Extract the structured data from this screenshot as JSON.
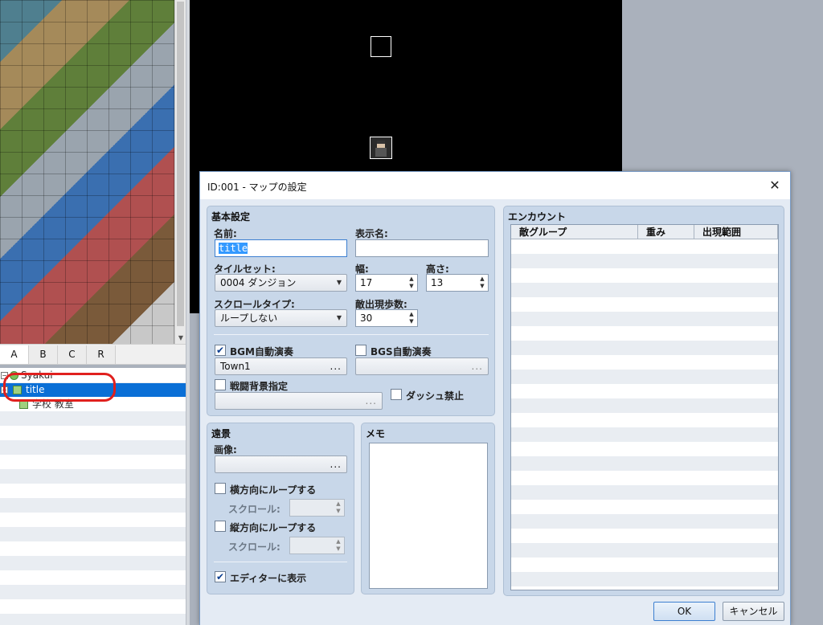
{
  "tileset_tabs": [
    "A",
    "B",
    "C",
    "R"
  ],
  "map_tree": {
    "items": [
      {
        "label": "Syakui"
      },
      {
        "label": "title"
      },
      {
        "label": "学校 教室"
      }
    ]
  },
  "dialog": {
    "title": "ID:001 - マップの設定",
    "close_glyph": "✕",
    "basic": {
      "group_title": "基本設定",
      "name_label": "名前:",
      "name_value": "title",
      "display_name_label": "表示名:",
      "display_name_value": "",
      "tileset_label": "タイルセット:",
      "tileset_value": "0004 ダンジョン",
      "width_label": "幅:",
      "width_value": "17",
      "height_label": "高さ:",
      "height_value": "13",
      "scroll_type_label": "スクロールタイプ:",
      "scroll_type_value": "ループしない",
      "encounter_steps_label": "敵出現歩数:",
      "encounter_steps_value": "30",
      "bgm_label": "BGM自動演奏",
      "bgm_checked": true,
      "bgm_value": "Town1",
      "bgs_label": "BGS自動演奏",
      "bgs_checked": false,
      "bgs_value": "",
      "battleback_label": "戦闘背景指定",
      "battleback_checked": false,
      "battleback_value": "",
      "dash_label": "ダッシュ禁止",
      "dash_checked": false,
      "ellipsis": "..."
    },
    "parallax": {
      "group_title": "遠景",
      "image_label": "画像:",
      "image_value": "",
      "loop_h_label": "横方向にループする",
      "loop_h_checked": false,
      "scroll_h_label": "スクロール:",
      "scroll_h_value": "",
      "loop_v_label": "縦方向にループする",
      "loop_v_checked": false,
      "scroll_v_label": "スクロール:",
      "scroll_v_value": "",
      "show_editor_label": "エディターに表示",
      "show_editor_checked": true
    },
    "memo": {
      "group_title": "メモ",
      "value": ""
    },
    "encounter": {
      "group_title": "エンカウント",
      "columns": [
        "敵グループ",
        "重み",
        "出現範囲"
      ]
    },
    "ok_label": "OK",
    "cancel_label": "キャンセル"
  },
  "colors": {
    "selection": "#0a6fd6",
    "annotation_ring": "#e0201e",
    "group_bg": "#c8d7e9"
  }
}
